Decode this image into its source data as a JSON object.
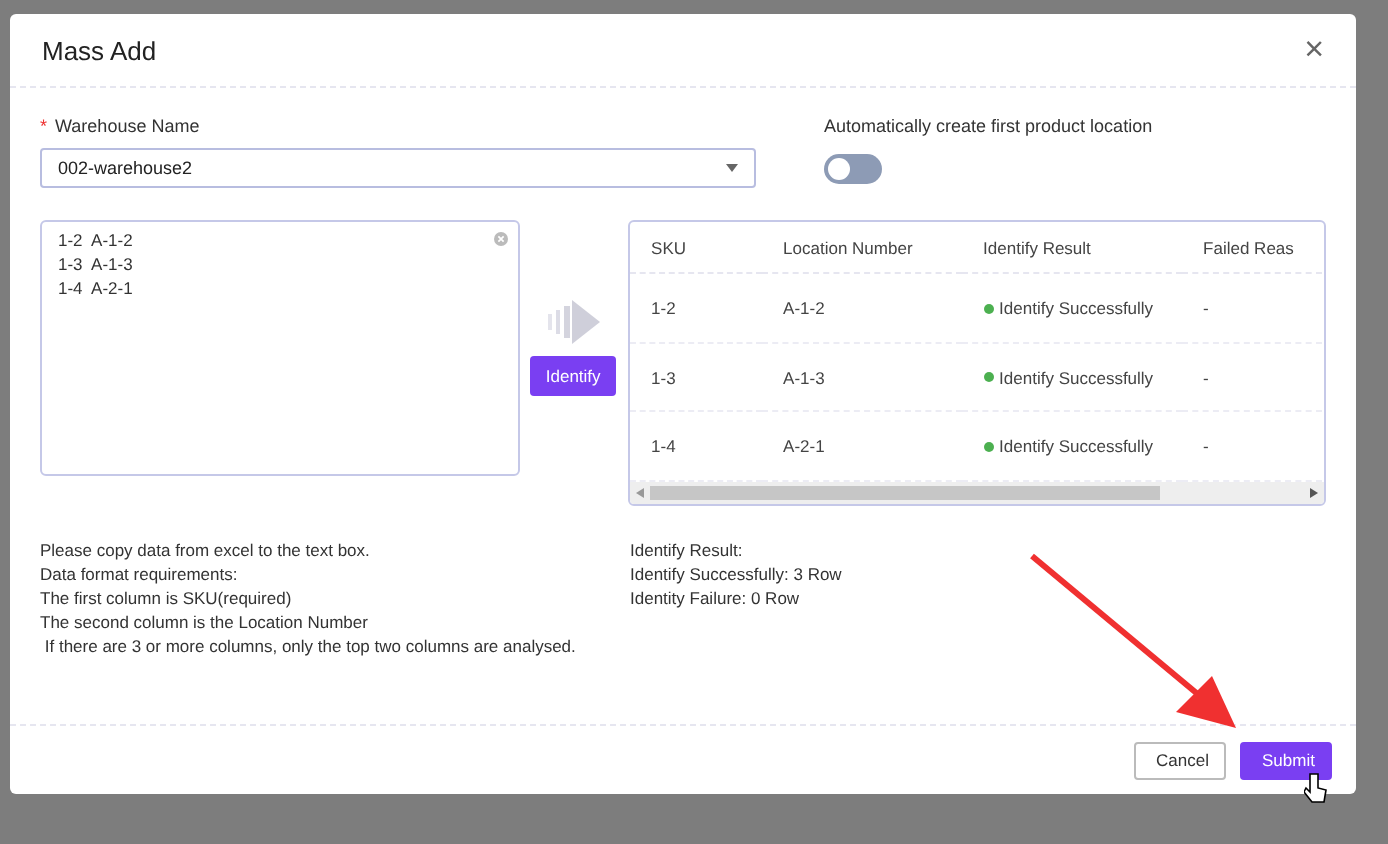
{
  "dialog": {
    "title": "Mass Add",
    "close": "×"
  },
  "warehouse": {
    "label": "Warehouse Name",
    "required": true,
    "required_mark": "*",
    "value": "002-warehouse2"
  },
  "auto_location": {
    "label": "Automatically create first product location",
    "on": false
  },
  "input_lines": [
    "1-2  A-1-2",
    "1-3  A-1-3",
    "1-4  A-2-1"
  ],
  "identify_button": "Identify",
  "table": {
    "columns": [
      "SKU",
      "Location Number",
      "Identify Result",
      "Failed Reas"
    ],
    "rows": [
      {
        "sku": "1-2",
        "location": "A-1-2",
        "result": "Identify Successfully",
        "reason": "-"
      },
      {
        "sku": "1-3",
        "location": "A-1-3",
        "result": "Identify Successfully",
        "reason": "-"
      },
      {
        "sku": "1-4",
        "location": "A-2-1",
        "result": "Identify Successfully",
        "reason": "-"
      }
    ]
  },
  "instructions": [
    "Please copy data from excel to the text box.",
    "Data format requirements:",
    "The first column is SKU(required)",
    "The second column is the Location Number",
    " If there are 3 or more columns, only the top two columns are analysed."
  ],
  "summary": [
    "Identify Result:",
    "Identify Successfully: 3 Row",
    "Identity Failure: 0 Row"
  ],
  "buttons": [
    {
      "label": "Cancel",
      "kind": "secondary"
    },
    {
      "label": "Submit",
      "kind": "primary"
    }
  ]
}
